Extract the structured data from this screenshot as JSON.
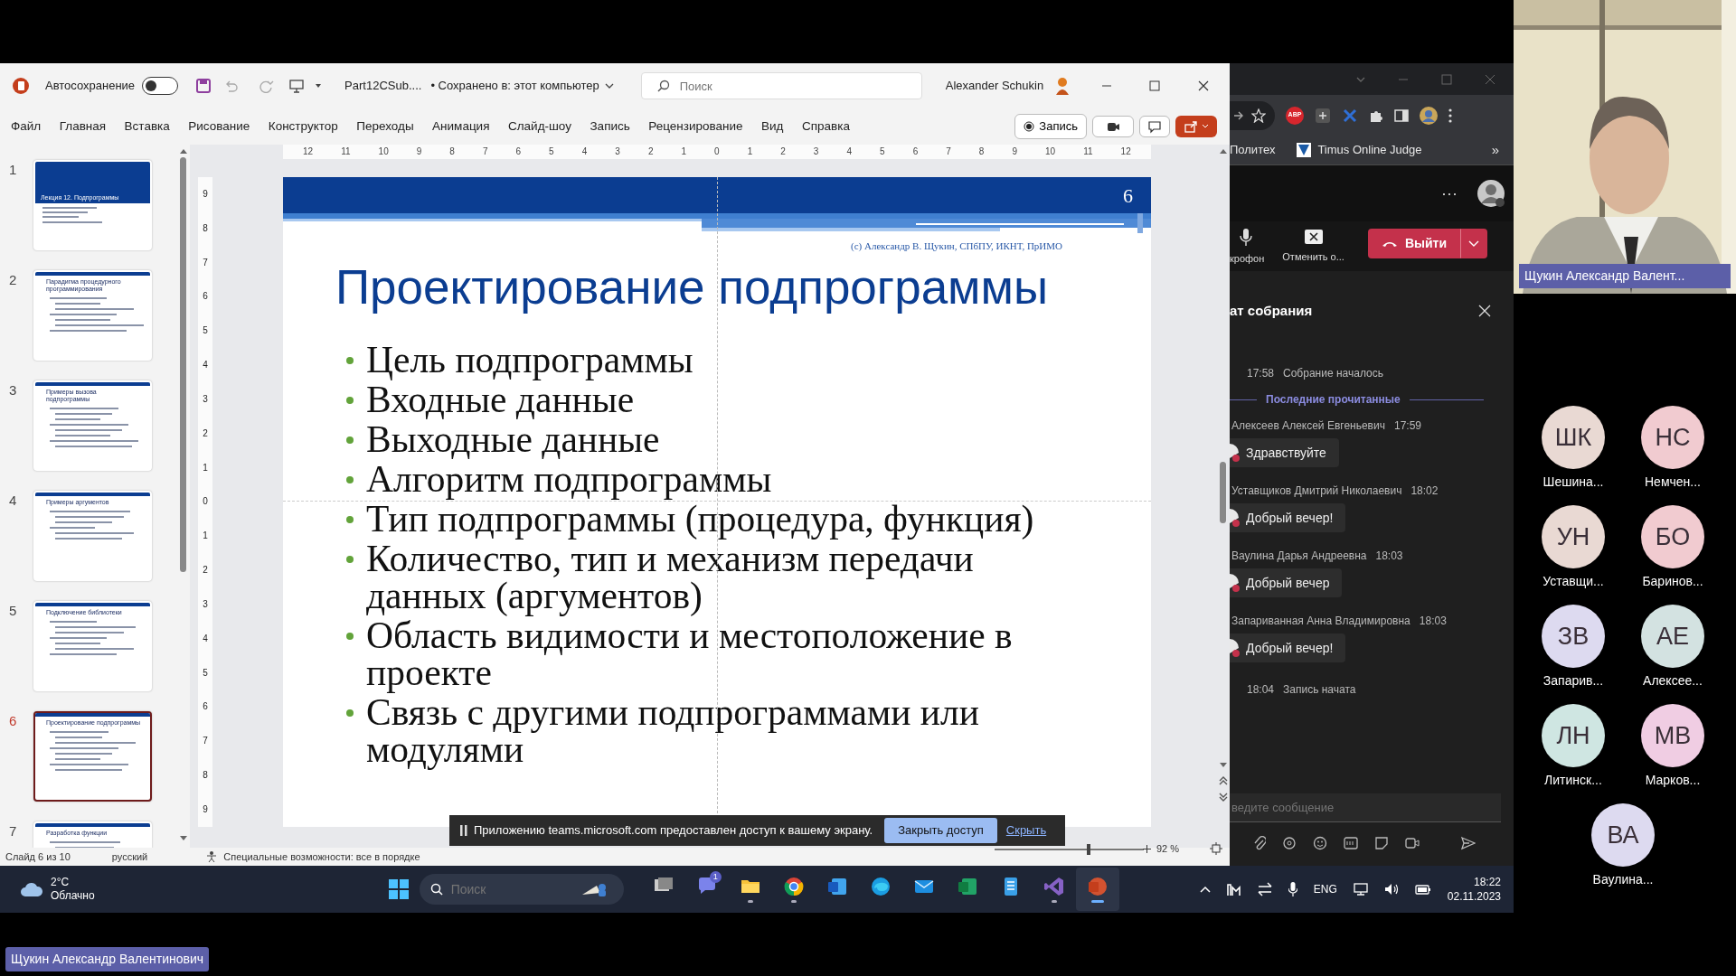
{
  "ppt": {
    "autosave": {
      "label": "Автосохранение",
      "on": false
    },
    "file_name": "Part12CSub....",
    "save_status": "• Сохранено в: этот компьютер",
    "search": {
      "placeholder": "Поиск"
    },
    "user": "Alexander Schukin",
    "menu": [
      {
        "label": "Файл"
      },
      {
        "label": "Главная"
      },
      {
        "label": "Вставка"
      },
      {
        "label": "Рисование"
      },
      {
        "label": "Конструктор"
      },
      {
        "label": "Переходы"
      },
      {
        "label": "Анимация"
      },
      {
        "label": "Слайд-шоу"
      },
      {
        "label": "Запись"
      },
      {
        "label": "Рецензирование"
      },
      {
        "label": "Вид"
      },
      {
        "label": "Справка"
      }
    ],
    "record_button": "Запись",
    "ruler_h": [
      "12",
      "11",
      "10",
      "9",
      "8",
      "7",
      "6",
      "5",
      "4",
      "3",
      "2",
      "1",
      "0",
      "1",
      "2",
      "3",
      "4",
      "5",
      "6",
      "7",
      "8",
      "9",
      "10",
      "11",
      "12"
    ],
    "ruler_v": [
      "9",
      "8",
      "7",
      "6",
      "5",
      "4",
      "3",
      "2",
      "1",
      "0",
      "1",
      "2",
      "3",
      "4",
      "5",
      "6",
      "7",
      "8",
      "9"
    ],
    "thumbnails": [
      {
        "number": "1",
        "kind": "title",
        "title": "Лекция 12. Подпрограммы",
        "selected": false
      },
      {
        "number": "2",
        "kind": "content",
        "title": "Парадигма процедурного программирования",
        "selected": false
      },
      {
        "number": "3",
        "kind": "content",
        "title": "Примеры вызова подпрограммы",
        "selected": false
      },
      {
        "number": "4",
        "kind": "content",
        "title": "Примеры аргументов",
        "selected": false
      },
      {
        "number": "5",
        "kind": "content",
        "title": "Подключение библиотеки",
        "selected": false
      },
      {
        "number": "6",
        "kind": "content",
        "title": "Проектирование подпрограммы",
        "selected": true
      },
      {
        "number": "7",
        "kind": "content",
        "title": "Разработка функции",
        "selected": false
      }
    ],
    "slide": {
      "number": "6",
      "credit": "(с) Александр В. Щукин, СПбПУ, ИКНТ, ПрИМО",
      "title": "Проектирование подпрограммы",
      "bullets": [
        "Цель подпрограммы",
        "Входные данные",
        "Выходные данные",
        "Алгоритм подпрограммы",
        "Тип подпрограммы (процедура, функция)",
        "Количество, тип и механизм передачи данных (аргументов)",
        "Область видимости и местоположение в проекте",
        "Связь с другими подпрограммами или модулями"
      ]
    },
    "status_bar": {
      "slide_info": "Слайд 6 из 10",
      "language": "русский",
      "accessibility": "Специальные возможности: все в порядке",
      "zoom": "92 %",
      "zoom_slider": {
        "level": 0.62
      }
    },
    "share_banner": {
      "text": "Приложению teams.microsoft.com предоставлен доступ к вашему экрану.",
      "stop_button": "Закрыть доступ",
      "hide_link": "Скрыть"
    }
  },
  "browser": {
    "extension_label": "ABP",
    "bookmarks": [
      {
        "label": "Политех",
        "kind": "plain"
      },
      {
        "label": "Timus Online Judge",
        "kind": "icon"
      }
    ],
    "more": "»"
  },
  "teams": {
    "more": "···",
    "controls": [
      {
        "label": "крофон",
        "kind": "mic"
      },
      {
        "label": "Отменить о...",
        "kind": "cancel"
      }
    ],
    "leave_button": "Выйти",
    "chat": {
      "title": "ат собрания",
      "events": [
        {
          "kind": "system",
          "time": "17:58",
          "text": "Собрание началось"
        },
        {
          "kind": "divider",
          "text": "Последние прочитанные"
        },
        {
          "kind": "message",
          "author": "Алексеев Алексей Евгеньевич",
          "time": "17:59",
          "text": "Здравствуйте"
        },
        {
          "kind": "message",
          "author": "Уставщиков Дмитрий Николаевич",
          "time": "18:02",
          "text": "Добрый вечер!"
        },
        {
          "kind": "message",
          "author": "Ваулина Дарья Андреевна",
          "time": "18:03",
          "text": "Добрый вечер"
        },
        {
          "kind": "message",
          "author": "Запариванная Анна Владимировна",
          "time": "18:03",
          "text": "Добрый вечер!"
        },
        {
          "kind": "system",
          "time": "18:04",
          "text": "Запись начата"
        }
      ],
      "input": {
        "placeholder": "ведите сообщение"
      }
    }
  },
  "taskbar": {
    "temperature": "2°C",
    "weather": "Облачно",
    "search": {
      "placeholder": "Поиск"
    },
    "apps": [
      {
        "kind": "taskview",
        "running": false,
        "active": false
      },
      {
        "kind": "chat",
        "badge": "1",
        "running": false,
        "active": false
      },
      {
        "kind": "folder",
        "running": true,
        "active": false
      },
      {
        "kind": "chrome",
        "running": true,
        "active": false
      },
      {
        "kind": "word",
        "running": false,
        "active": false
      },
      {
        "kind": "edge",
        "running": false,
        "active": false
      },
      {
        "kind": "mail",
        "running": false,
        "active": false
      },
      {
        "kind": "excel",
        "running": false,
        "active": false
      },
      {
        "kind": "notes",
        "running": false,
        "active": false
      },
      {
        "kind": "vs",
        "running": true,
        "active": false
      },
      {
        "kind": "powerpoint",
        "running": true,
        "active": true
      }
    ],
    "language": "ENG",
    "time": "18:22",
    "date": "02.11.2023"
  },
  "stage": {
    "speaker": {
      "name": "Щукин Александр Валент..."
    },
    "participants": [
      {
        "initials": "ШК",
        "name": "Шешина...",
        "color": "#e9d9d3"
      },
      {
        "initials": "НС",
        "name": "Немчен...",
        "color": "#f1cbd0"
      },
      {
        "initials": "УН",
        "name": "Уставщи...",
        "color": "#e9d9d3"
      },
      {
        "initials": "БО",
        "name": "Баринов...",
        "color": "#f1cbd0"
      },
      {
        "initials": "ЗВ",
        "name": "Запарив...",
        "color": "#dddaf0"
      },
      {
        "initials": "АЕ",
        "name": "Алексее...",
        "color": "#d3e2e1"
      },
      {
        "initials": "ЛН",
        "name": "Литинск...",
        "color": "#cfe6e2"
      },
      {
        "initials": "МВ",
        "name": "Марков...",
        "color": "#f0cde3"
      },
      {
        "initials": "ВА",
        "name": "Ваулина...",
        "color": "#dddaf0"
      }
    ],
    "presenter": "Щукин Александр Валентинович"
  }
}
